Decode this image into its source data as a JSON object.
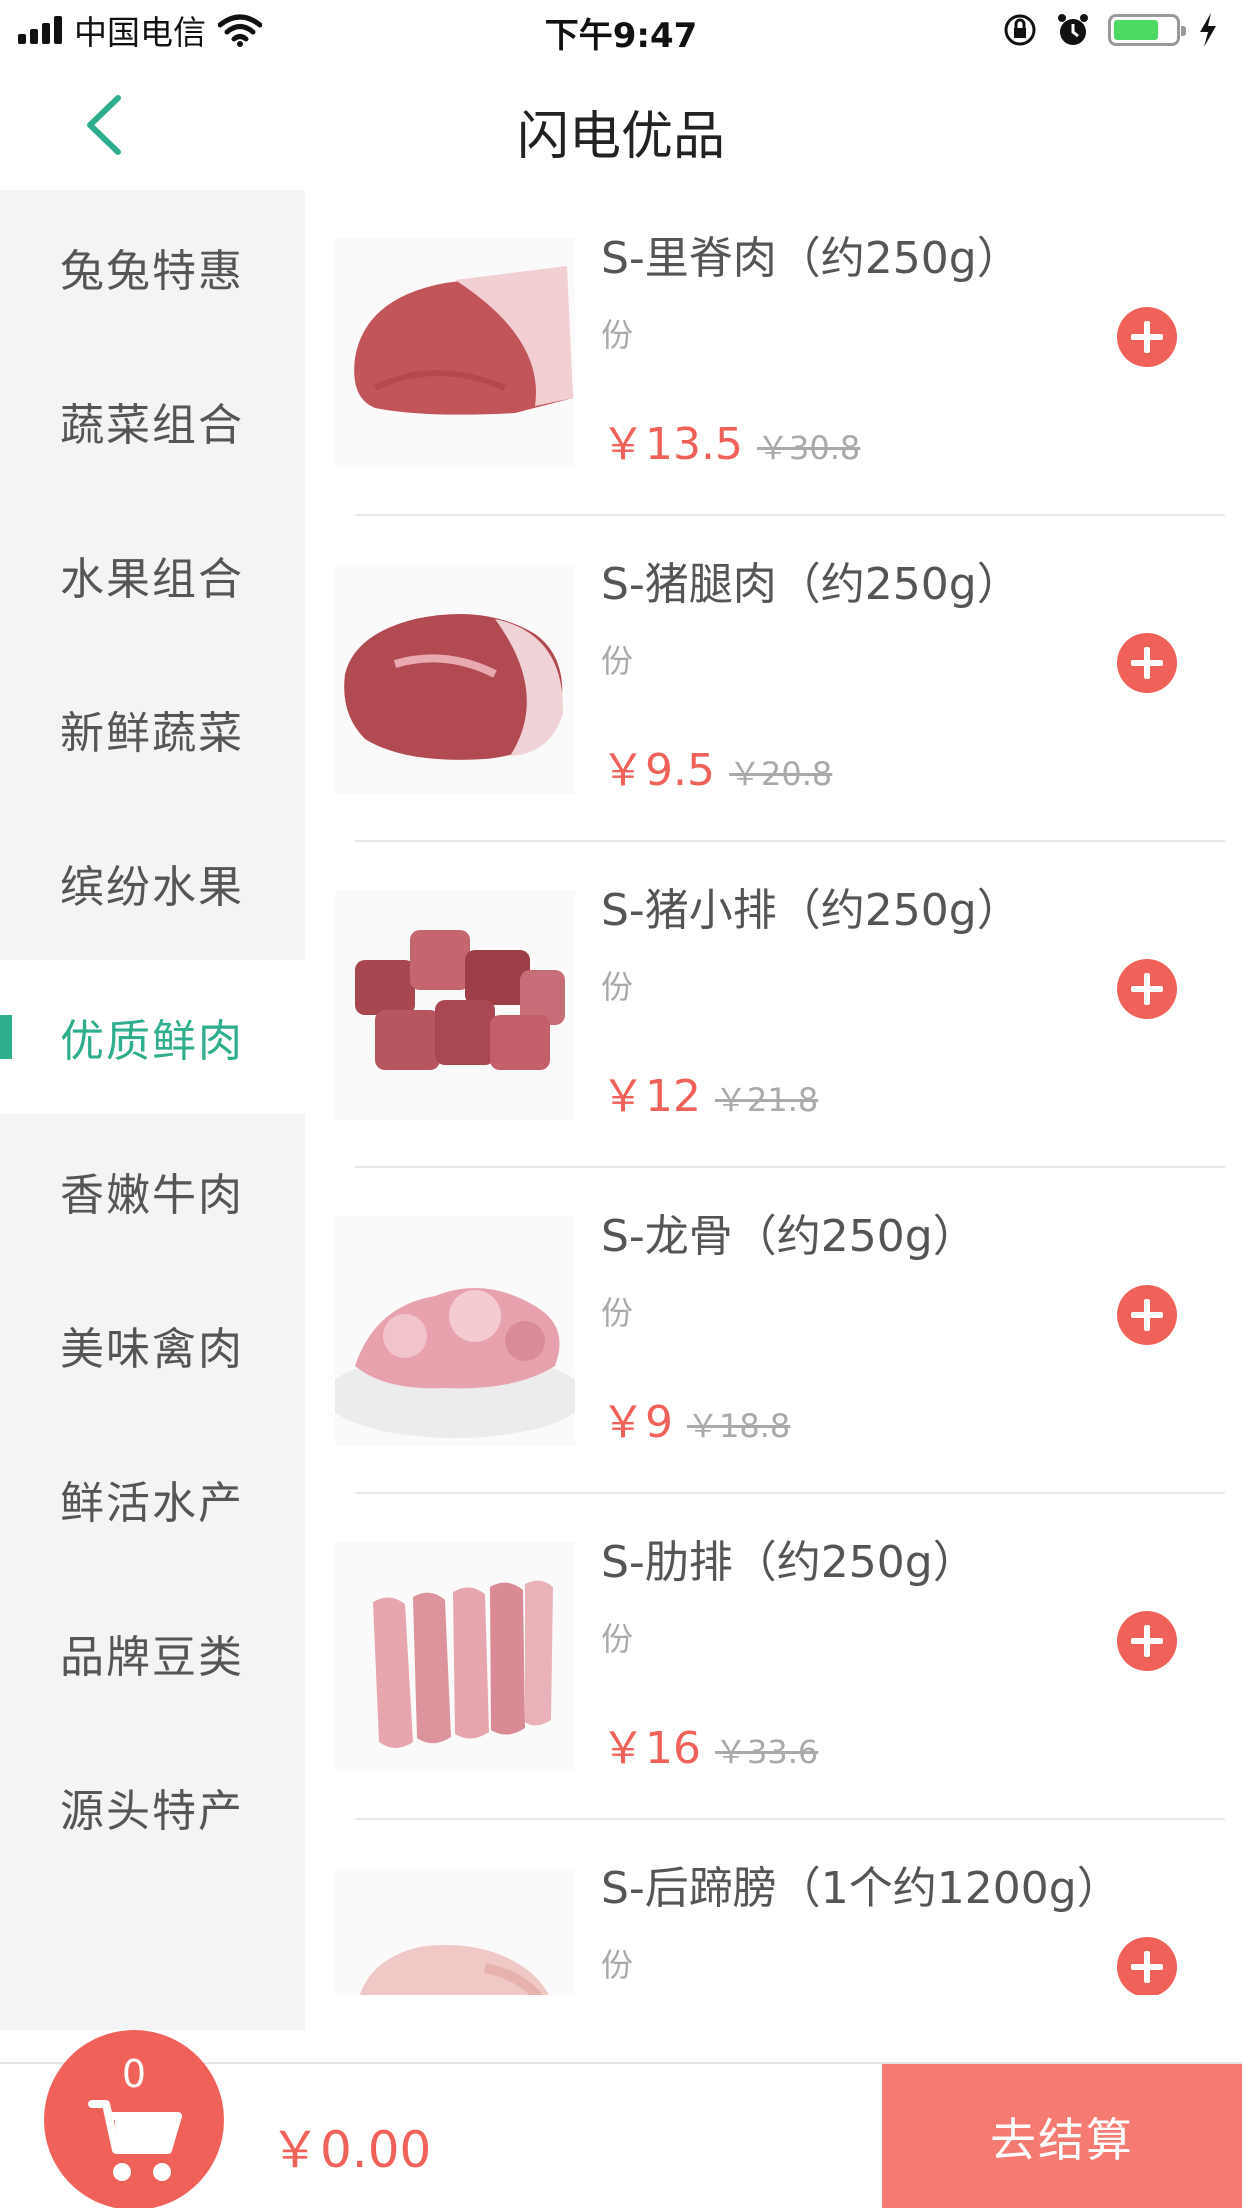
{
  "status_bar": {
    "carrier": "中国电信",
    "time": "下午9:47"
  },
  "nav": {
    "title": "闪电优品"
  },
  "sidebar": {
    "items": [
      {
        "label": "兔兔特惠",
        "active": false
      },
      {
        "label": "蔬菜组合",
        "active": false
      },
      {
        "label": "水果组合",
        "active": false
      },
      {
        "label": "新鲜蔬菜",
        "active": false
      },
      {
        "label": "缤纷水果",
        "active": false
      },
      {
        "label": "优质鲜肉",
        "active": true
      },
      {
        "label": "香嫩牛肉",
        "active": false
      },
      {
        "label": "美味禽肉",
        "active": false
      },
      {
        "label": "鲜活水产",
        "active": false
      },
      {
        "label": "品牌豆类",
        "active": false
      },
      {
        "label": "源头特产",
        "active": false
      }
    ]
  },
  "products": [
    {
      "name": "S-里脊肉（约250g）",
      "unit": "份",
      "price": "￥13.5",
      "original_price": "￥30.8"
    },
    {
      "name": "S-猪腿肉（约250g）",
      "unit": "份",
      "price": "￥9.5",
      "original_price": "￥20.8"
    },
    {
      "name": "S-猪小排（约250g）",
      "unit": "份",
      "price": "￥12",
      "original_price": "￥21.8"
    },
    {
      "name": "S-龙骨（约250g）",
      "unit": "份",
      "price": "￥9",
      "original_price": "￥18.8"
    },
    {
      "name": "S-肋排（约250g）",
      "unit": "份",
      "price": "￥16",
      "original_price": "￥33.6"
    },
    {
      "name": "S-后蹄膀（1个约1200g）",
      "unit": "份",
      "price": "",
      "original_price": ""
    }
  ],
  "cart": {
    "count": "0",
    "total": "￥0.00",
    "checkout_label": "去结算"
  },
  "colors": {
    "accent_green": "#2fae8d",
    "price_red": "#f0615a",
    "checkout_bg": "#f47a72"
  }
}
